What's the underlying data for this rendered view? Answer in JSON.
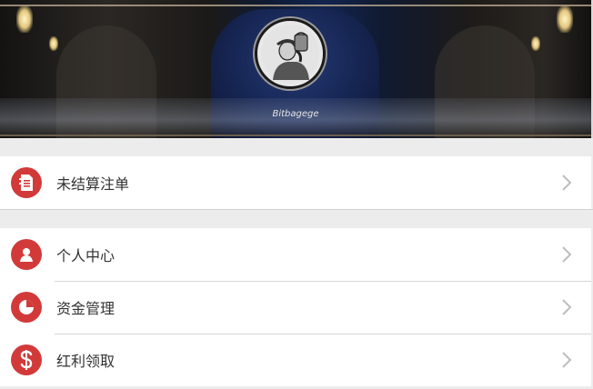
{
  "banner": {
    "logo_caption": "Bitbagege"
  },
  "section1": {
    "items": [
      {
        "label": "未结算注单",
        "icon": "document-icon"
      }
    ]
  },
  "section2": {
    "items": [
      {
        "label": "个人中心",
        "icon": "user-icon"
      },
      {
        "label": "资金管理",
        "icon": "pie-chart-icon"
      },
      {
        "label": "红利领取",
        "icon": "dollar-icon"
      }
    ]
  },
  "colors": {
    "icon_bg": "#d23a3a",
    "chevron": "#bdbdbd",
    "page_bg": "#ececec"
  }
}
